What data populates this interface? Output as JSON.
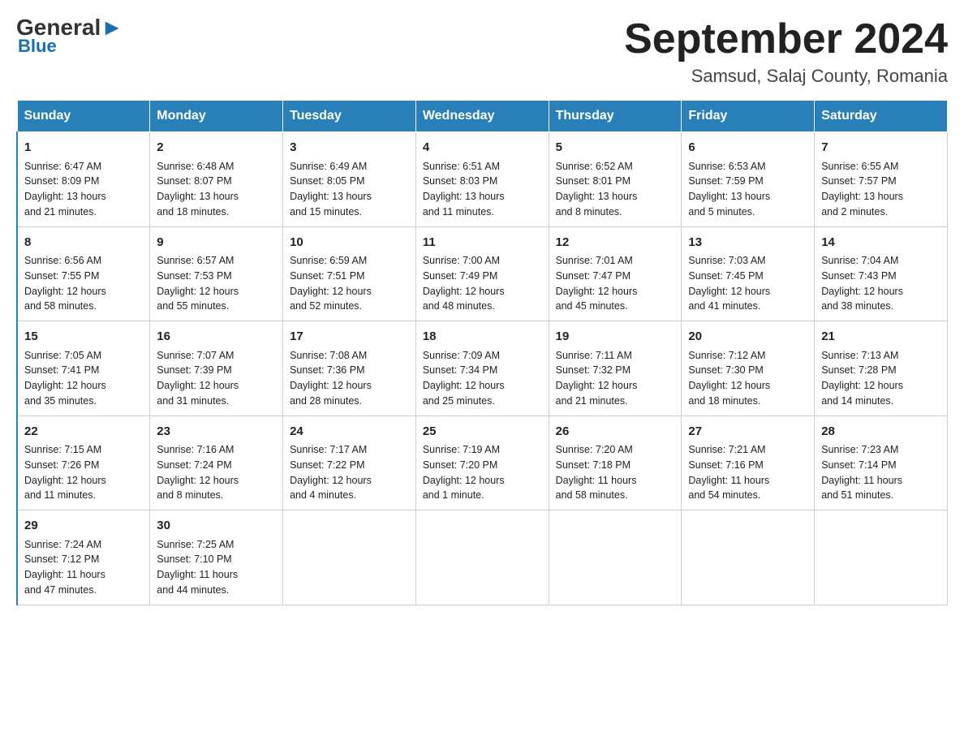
{
  "header": {
    "logo_general": "General",
    "logo_blue": "Blue",
    "month_title": "September 2024",
    "location": "Samsud, Salaj County, Romania"
  },
  "days_of_week": [
    "Sunday",
    "Monday",
    "Tuesday",
    "Wednesday",
    "Thursday",
    "Friday",
    "Saturday"
  ],
  "weeks": [
    [
      {
        "day": "1",
        "info": "Sunrise: 6:47 AM\nSunset: 8:09 PM\nDaylight: 13 hours\nand 21 minutes."
      },
      {
        "day": "2",
        "info": "Sunrise: 6:48 AM\nSunset: 8:07 PM\nDaylight: 13 hours\nand 18 minutes."
      },
      {
        "day": "3",
        "info": "Sunrise: 6:49 AM\nSunset: 8:05 PM\nDaylight: 13 hours\nand 15 minutes."
      },
      {
        "day": "4",
        "info": "Sunrise: 6:51 AM\nSunset: 8:03 PM\nDaylight: 13 hours\nand 11 minutes."
      },
      {
        "day": "5",
        "info": "Sunrise: 6:52 AM\nSunset: 8:01 PM\nDaylight: 13 hours\nand 8 minutes."
      },
      {
        "day": "6",
        "info": "Sunrise: 6:53 AM\nSunset: 7:59 PM\nDaylight: 13 hours\nand 5 minutes."
      },
      {
        "day": "7",
        "info": "Sunrise: 6:55 AM\nSunset: 7:57 PM\nDaylight: 13 hours\nand 2 minutes."
      }
    ],
    [
      {
        "day": "8",
        "info": "Sunrise: 6:56 AM\nSunset: 7:55 PM\nDaylight: 12 hours\nand 58 minutes."
      },
      {
        "day": "9",
        "info": "Sunrise: 6:57 AM\nSunset: 7:53 PM\nDaylight: 12 hours\nand 55 minutes."
      },
      {
        "day": "10",
        "info": "Sunrise: 6:59 AM\nSunset: 7:51 PM\nDaylight: 12 hours\nand 52 minutes."
      },
      {
        "day": "11",
        "info": "Sunrise: 7:00 AM\nSunset: 7:49 PM\nDaylight: 12 hours\nand 48 minutes."
      },
      {
        "day": "12",
        "info": "Sunrise: 7:01 AM\nSunset: 7:47 PM\nDaylight: 12 hours\nand 45 minutes."
      },
      {
        "day": "13",
        "info": "Sunrise: 7:03 AM\nSunset: 7:45 PM\nDaylight: 12 hours\nand 41 minutes."
      },
      {
        "day": "14",
        "info": "Sunrise: 7:04 AM\nSunset: 7:43 PM\nDaylight: 12 hours\nand 38 minutes."
      }
    ],
    [
      {
        "day": "15",
        "info": "Sunrise: 7:05 AM\nSunset: 7:41 PM\nDaylight: 12 hours\nand 35 minutes."
      },
      {
        "day": "16",
        "info": "Sunrise: 7:07 AM\nSunset: 7:39 PM\nDaylight: 12 hours\nand 31 minutes."
      },
      {
        "day": "17",
        "info": "Sunrise: 7:08 AM\nSunset: 7:36 PM\nDaylight: 12 hours\nand 28 minutes."
      },
      {
        "day": "18",
        "info": "Sunrise: 7:09 AM\nSunset: 7:34 PM\nDaylight: 12 hours\nand 25 minutes."
      },
      {
        "day": "19",
        "info": "Sunrise: 7:11 AM\nSunset: 7:32 PM\nDaylight: 12 hours\nand 21 minutes."
      },
      {
        "day": "20",
        "info": "Sunrise: 7:12 AM\nSunset: 7:30 PM\nDaylight: 12 hours\nand 18 minutes."
      },
      {
        "day": "21",
        "info": "Sunrise: 7:13 AM\nSunset: 7:28 PM\nDaylight: 12 hours\nand 14 minutes."
      }
    ],
    [
      {
        "day": "22",
        "info": "Sunrise: 7:15 AM\nSunset: 7:26 PM\nDaylight: 12 hours\nand 11 minutes."
      },
      {
        "day": "23",
        "info": "Sunrise: 7:16 AM\nSunset: 7:24 PM\nDaylight: 12 hours\nand 8 minutes."
      },
      {
        "day": "24",
        "info": "Sunrise: 7:17 AM\nSunset: 7:22 PM\nDaylight: 12 hours\nand 4 minutes."
      },
      {
        "day": "25",
        "info": "Sunrise: 7:19 AM\nSunset: 7:20 PM\nDaylight: 12 hours\nand 1 minute."
      },
      {
        "day": "26",
        "info": "Sunrise: 7:20 AM\nSunset: 7:18 PM\nDaylight: 11 hours\nand 58 minutes."
      },
      {
        "day": "27",
        "info": "Sunrise: 7:21 AM\nSunset: 7:16 PM\nDaylight: 11 hours\nand 54 minutes."
      },
      {
        "day": "28",
        "info": "Sunrise: 7:23 AM\nSunset: 7:14 PM\nDaylight: 11 hours\nand 51 minutes."
      }
    ],
    [
      {
        "day": "29",
        "info": "Sunrise: 7:24 AM\nSunset: 7:12 PM\nDaylight: 11 hours\nand 47 minutes."
      },
      {
        "day": "30",
        "info": "Sunrise: 7:25 AM\nSunset: 7:10 PM\nDaylight: 11 hours\nand 44 minutes."
      },
      {
        "day": "",
        "info": ""
      },
      {
        "day": "",
        "info": ""
      },
      {
        "day": "",
        "info": ""
      },
      {
        "day": "",
        "info": ""
      },
      {
        "day": "",
        "info": ""
      }
    ]
  ]
}
